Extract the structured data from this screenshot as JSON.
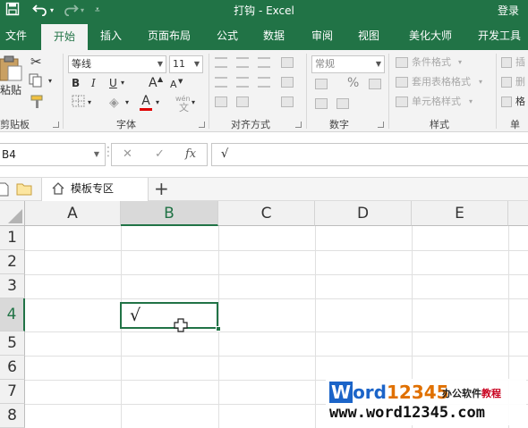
{
  "titlebar": {
    "title": "打钩 - Excel",
    "login": "登录",
    "save_icon": "save-icon",
    "undo_icon": "undo-icon",
    "redo_icon": "redo-icon",
    "brand_color": "#217346"
  },
  "tabs": [
    "文件",
    "开始",
    "插入",
    "页面布局",
    "公式",
    "数据",
    "审阅",
    "视图",
    "美化大师",
    "开发工具"
  ],
  "active_tab": "开始",
  "ribbon": {
    "clipboard": {
      "paste": "粘贴",
      "label": "剪贴板"
    },
    "font": {
      "name": "等线",
      "size": "11",
      "bold": "B",
      "italic": "I",
      "underline": "U",
      "grow": "A",
      "shrink": "A",
      "font_color": "A",
      "wen": "wén",
      "wen_char": "文",
      "label": "字体"
    },
    "alignment": {
      "label": "对齐方式"
    },
    "number": {
      "format": "常规",
      "percent": "%",
      "label": "数字"
    },
    "styles": {
      "conditional": "条件格式",
      "table": "套用表格格式",
      "cell": "单元格样式",
      "label": "样式"
    },
    "cells": {
      "insert": "插",
      "delete": "删",
      "format": "格",
      "label": "单元"
    }
  },
  "formula_bar": {
    "name_box": "B4",
    "cancel": "✕",
    "enter": "✓",
    "fx": "fx",
    "content": "√"
  },
  "doc_tabs": {
    "template_zone": "模板专区",
    "add": "+"
  },
  "grid": {
    "columns": [
      "A",
      "B",
      "C",
      "D",
      "E"
    ],
    "rows": [
      "1",
      "2",
      "3",
      "4",
      "5",
      "6",
      "7",
      "8"
    ],
    "selected_column": "B",
    "selected_row": "4",
    "selected_cell_value": "√"
  },
  "watermark": {
    "logo_w": "W",
    "logo_ord": "ord",
    "logo_num": "12345",
    "tagline": "办公软件",
    "tagline_red": "教程",
    "url": "www.word12345.com"
  }
}
